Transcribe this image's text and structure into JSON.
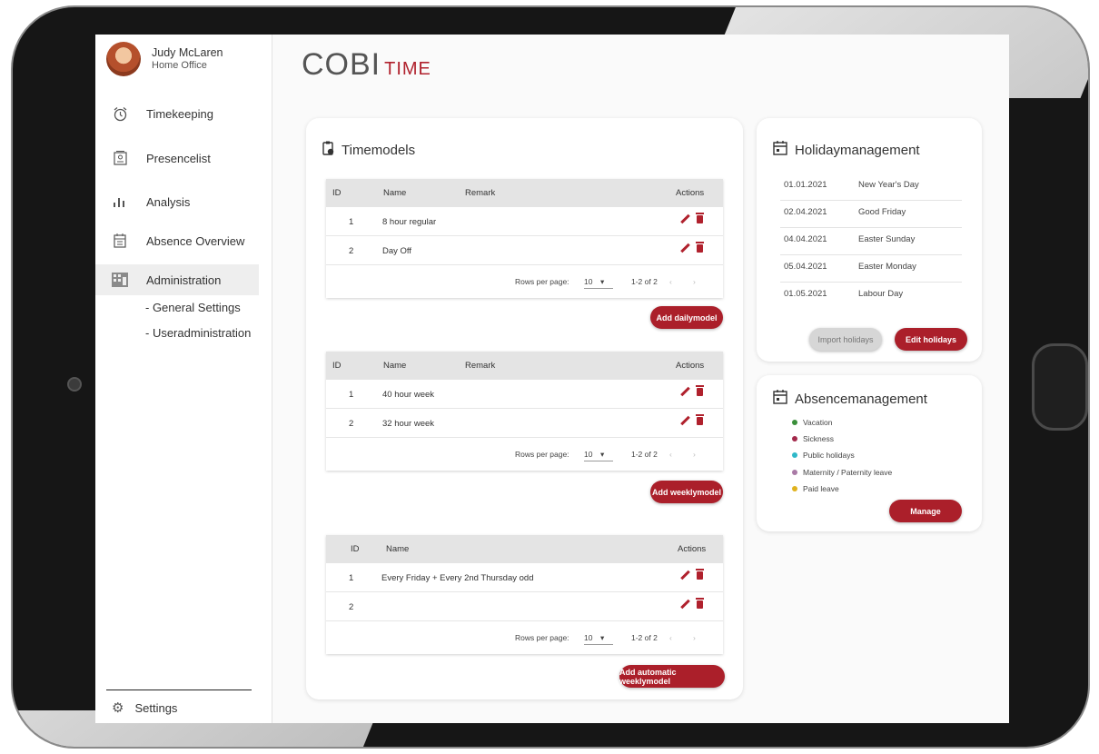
{
  "user": {
    "name": "Judy McLaren",
    "location": "Home Office"
  },
  "nav": {
    "timekeeping": "Timekeeping",
    "presencelist": "Presencelist",
    "analysis": "Analysis",
    "absence_overview": "Absence Overview",
    "administration": "Administration",
    "general_settings": "- General Settings",
    "useradministration": "- Useradministration",
    "settings": "Settings"
  },
  "logo": {
    "main": "COBI",
    "sub": "TIME"
  },
  "timemodels": {
    "title": "Timemodels",
    "headers": {
      "id": "ID",
      "name": "Name",
      "remark": "Remark",
      "actions": "Actions"
    },
    "daily": {
      "rows": [
        {
          "id": "1",
          "name": "8 hour regular"
        },
        {
          "id": "2",
          "name": "Day Off"
        }
      ],
      "rows_per_page_label": "Rows per page:",
      "rows_per_page": "10",
      "range": "1-2 of 2",
      "add_button": "Add dailymodel"
    },
    "weekly": {
      "rows": [
        {
          "id": "1",
          "name": "40 hour week"
        },
        {
          "id": "2",
          "name": "32 hour week"
        }
      ],
      "rows_per_page_label": "Rows per page:",
      "rows_per_page": "10",
      "range": "1-2 of 2",
      "add_button": "Add weeklymodel"
    },
    "automatic": {
      "rows": [
        {
          "id": "1",
          "name": "Every Friday + Every 2nd Thursday odd"
        },
        {
          "id": "2",
          "name": ""
        }
      ],
      "rows_per_page_label": "Rows per page:",
      "rows_per_page": "10",
      "range": "1-2 of 2",
      "add_button": "Add automatic weeklymodel"
    }
  },
  "holiday": {
    "title": "Holidaymanagement",
    "items": [
      {
        "date": "01.01.2021",
        "name": "New Year's Day"
      },
      {
        "date": "02.04.2021",
        "name": "Good Friday"
      },
      {
        "date": "04.04.2021",
        "name": "Easter Sunday"
      },
      {
        "date": "05.04.2021",
        "name": "Easter Monday"
      },
      {
        "date": "01.05.2021",
        "name": "Labour Day"
      }
    ],
    "import_button": "Import holidays",
    "edit_button": "Edit holidays"
  },
  "absence": {
    "title": "Absencemanagement",
    "items": [
      {
        "label": "Vacation",
        "color": "#3a8f3a"
      },
      {
        "label": "Sickness",
        "color": "#a3294b"
      },
      {
        "label": "Public holidays",
        "color": "#2fb8c8"
      },
      {
        "label": "Maternity / Paternity leave",
        "color": "#a97aa6"
      },
      {
        "label": "Paid leave",
        "color": "#e0b21e"
      }
    ],
    "manage_button": "Manage"
  },
  "colors": {
    "accent": "#ab1f2a",
    "header_bg": "#e4e4e4"
  }
}
